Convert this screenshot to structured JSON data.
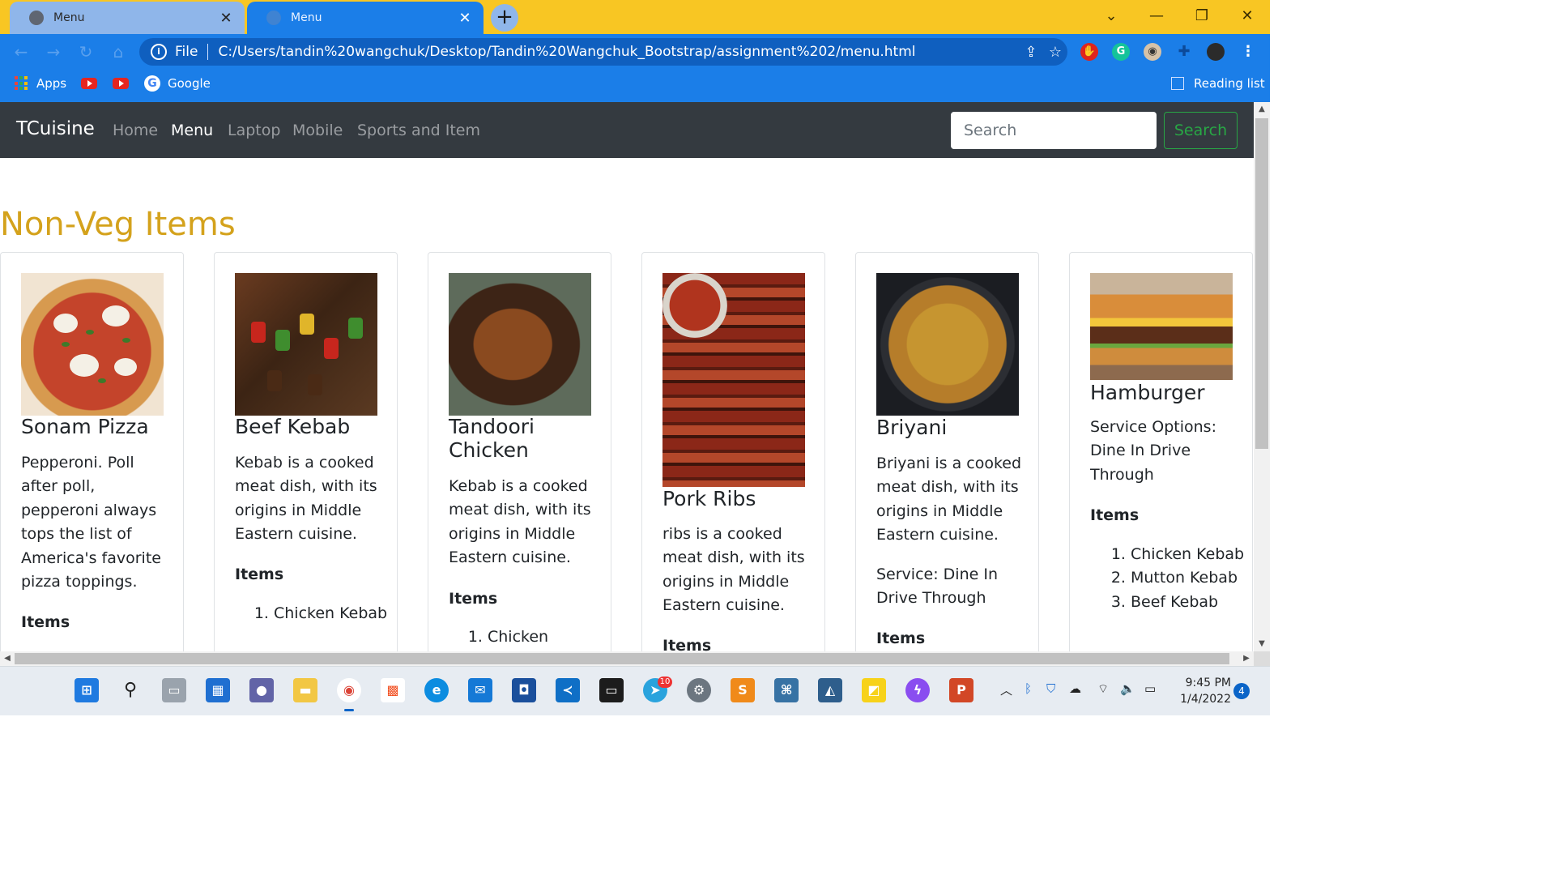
{
  "browser": {
    "tabs": [
      {
        "title": "Menu",
        "active": false
      },
      {
        "title": "Menu",
        "active": true
      }
    ],
    "new_tab_label": "+",
    "url_scheme_label": "File",
    "url": "C:/Users/tandin%20wangchuk/Desktop/Tandin%20Wangchuk_Bootstrap/assignment%202/menu.html",
    "bookmarks": {
      "apps_label": "Apps",
      "google_label": "Google",
      "reading_list_label": "Reading list"
    },
    "colors": {
      "title_bar": "#f8c623",
      "toolbar": "#1b7ee8"
    }
  },
  "site": {
    "brand": "TCuisine",
    "nav_links": [
      "Home",
      "Menu",
      "Laptop",
      "Mobile",
      "Sports and Item"
    ],
    "active_nav": "Menu",
    "search_placeholder": "Search",
    "search_button": "Search",
    "section_title": "Non-Veg Items",
    "accent_color": "#d4a21c"
  },
  "cards": [
    {
      "title": "Sonam Pizza",
      "body": "Pepperoni. Poll after poll, pepperoni always tops the list of America's favorite pizza toppings.",
      "items_heading": "Items",
      "image": "pizza-image"
    },
    {
      "title": "Beef Kebab",
      "body": "Kebab is a cooked meat dish, with its origins in Middle Eastern cuisine.",
      "items_heading": "Items",
      "items": [
        "Chicken Kebab"
      ],
      "image": "kebab-image"
    },
    {
      "title": "Tandoori Chicken",
      "body": "Kebab is a cooked meat dish, with its origins in Middle Eastern cuisine.",
      "items_heading": "Items",
      "items": [
        "Chicken"
      ],
      "image": "tandoori-chicken-image"
    },
    {
      "title": "Pork Ribs",
      "body": "ribs is a cooked meat dish, with its origins in Middle Eastern cuisine.",
      "items_heading": "Items",
      "image": "pork-ribs-image"
    },
    {
      "title": "Briyani",
      "body": "Briyani is a cooked meat dish, with its origins in Middle Eastern cuisine.",
      "service_label": "Service:",
      "service_options": "Dine In Drive Through",
      "items_heading": "Items",
      "image": "briyani-image"
    },
    {
      "title": "Hamburger",
      "service_label": "Service Options:",
      "service_options": "Dine In Drive Through",
      "items_heading": "Items",
      "items": [
        "Chicken Kebab",
        "Mutton Kebab",
        "Beef Kebab"
      ],
      "image": "hamburger-image"
    }
  ],
  "taskbar": {
    "telegram_badge": "10",
    "time": "9:45 PM",
    "date": "1/4/2022",
    "notification_count": "4"
  }
}
